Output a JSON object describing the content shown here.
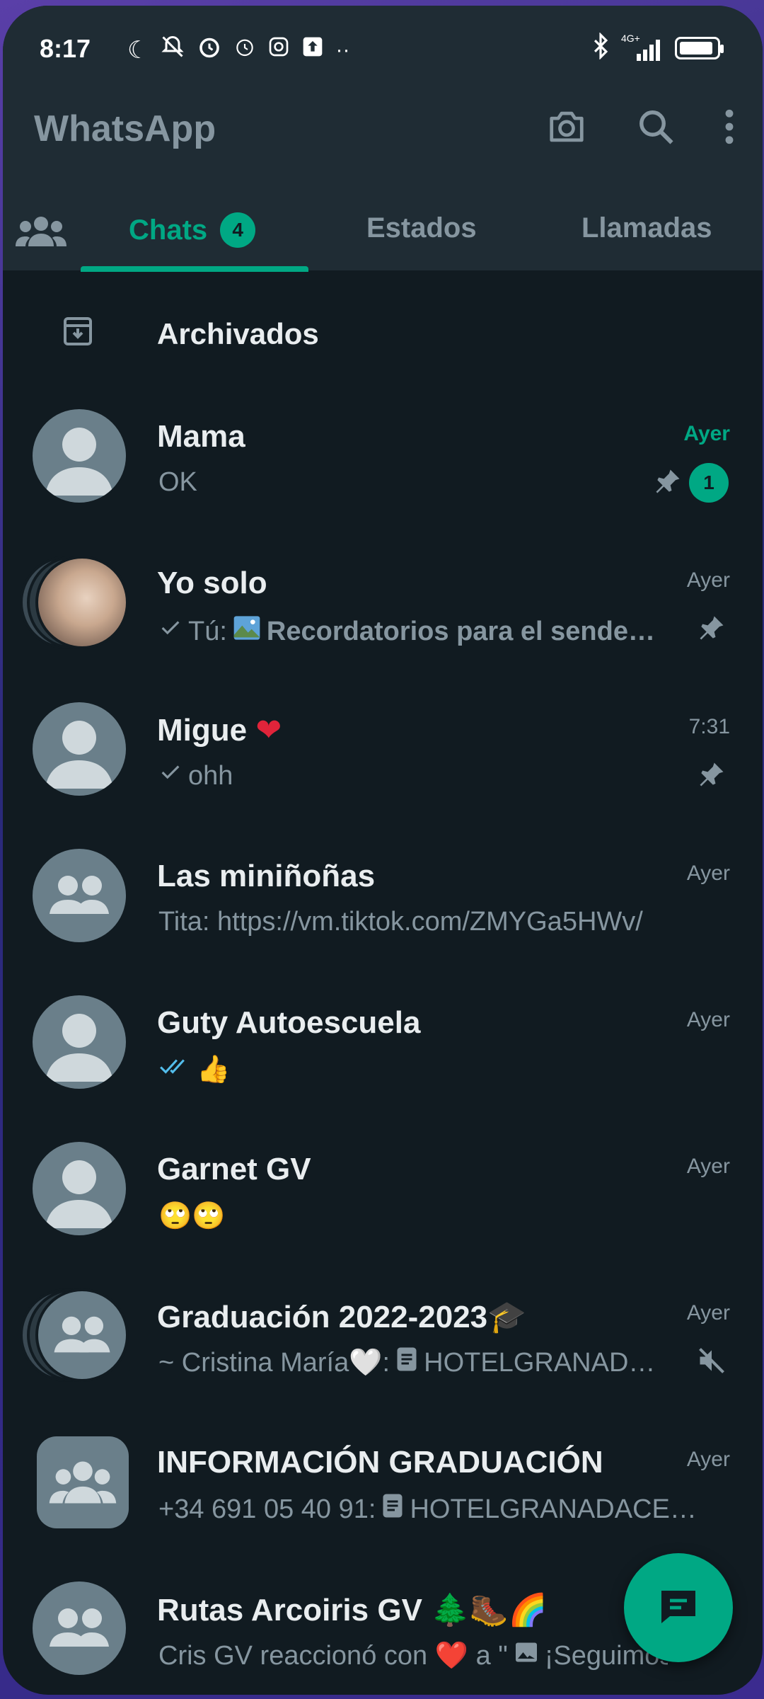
{
  "status_bar": {
    "time": "8:17",
    "network_label": "4G+",
    "icons": [
      "moon-icon",
      "bell-off-icon",
      "alarm-icon",
      "alarm-icon",
      "instagram-icon",
      "upload-icon",
      "more-dots-icon",
      "bluetooth-icon",
      "signal-icon",
      "battery-icon"
    ]
  },
  "app_bar": {
    "title": "WhatsApp",
    "actions": [
      "camera-icon",
      "search-icon",
      "overflow-menu-icon"
    ]
  },
  "tabs": {
    "chats": "Chats",
    "chats_badge": "4",
    "estados": "Estados",
    "llamadas": "Llamadas",
    "active": "Chats"
  },
  "archived": {
    "label": "Archivados"
  },
  "chats": [
    {
      "name": "Mama",
      "time": "Ayer",
      "message": "OK",
      "unread": "1",
      "pinned": true
    },
    {
      "name": "Yo solo",
      "time": "Ayer",
      "prefix": "Tú:",
      "message": "Recordatorios para el sende…",
      "pinned": true
    },
    {
      "name": "Migue",
      "time": "7:31",
      "message": "ohh",
      "pinned": true
    },
    {
      "name": "Las miniñoñas",
      "time": "Ayer",
      "message": "Tita: https://vm.tiktok.com/ZMYGa5HWv/"
    },
    {
      "name": "Guty Autoescuela",
      "time": "Ayer",
      "message": "👍"
    },
    {
      "name": "Garnet GV",
      "time": "Ayer",
      "message": "🙄🙄"
    },
    {
      "name": "Graduación 2022-2023🎓",
      "time": "Ayer",
      "message": "~ Cristina María🤍: ",
      "message_file": "HOTELGRANAD…",
      "muted": true
    },
    {
      "name": "INFORMACIÓN GRADUACIÓN",
      "time": "Ayer",
      "message": "+34 691 05 40 91: ",
      "message_file": "HOTELGRANADACE…"
    },
    {
      "name": "Rutas Arcoiris GV 🌲🥾🌈",
      "message": "Cris GV reaccionó con ❤️ a \"",
      "message_file": "¡Seguimos…"
    }
  ],
  "colors": {
    "accent": "#00a884",
    "background": "#111b21",
    "header": "#1f2c34",
    "secondary_text": "#8696a0",
    "primary_text": "#e9edef"
  }
}
